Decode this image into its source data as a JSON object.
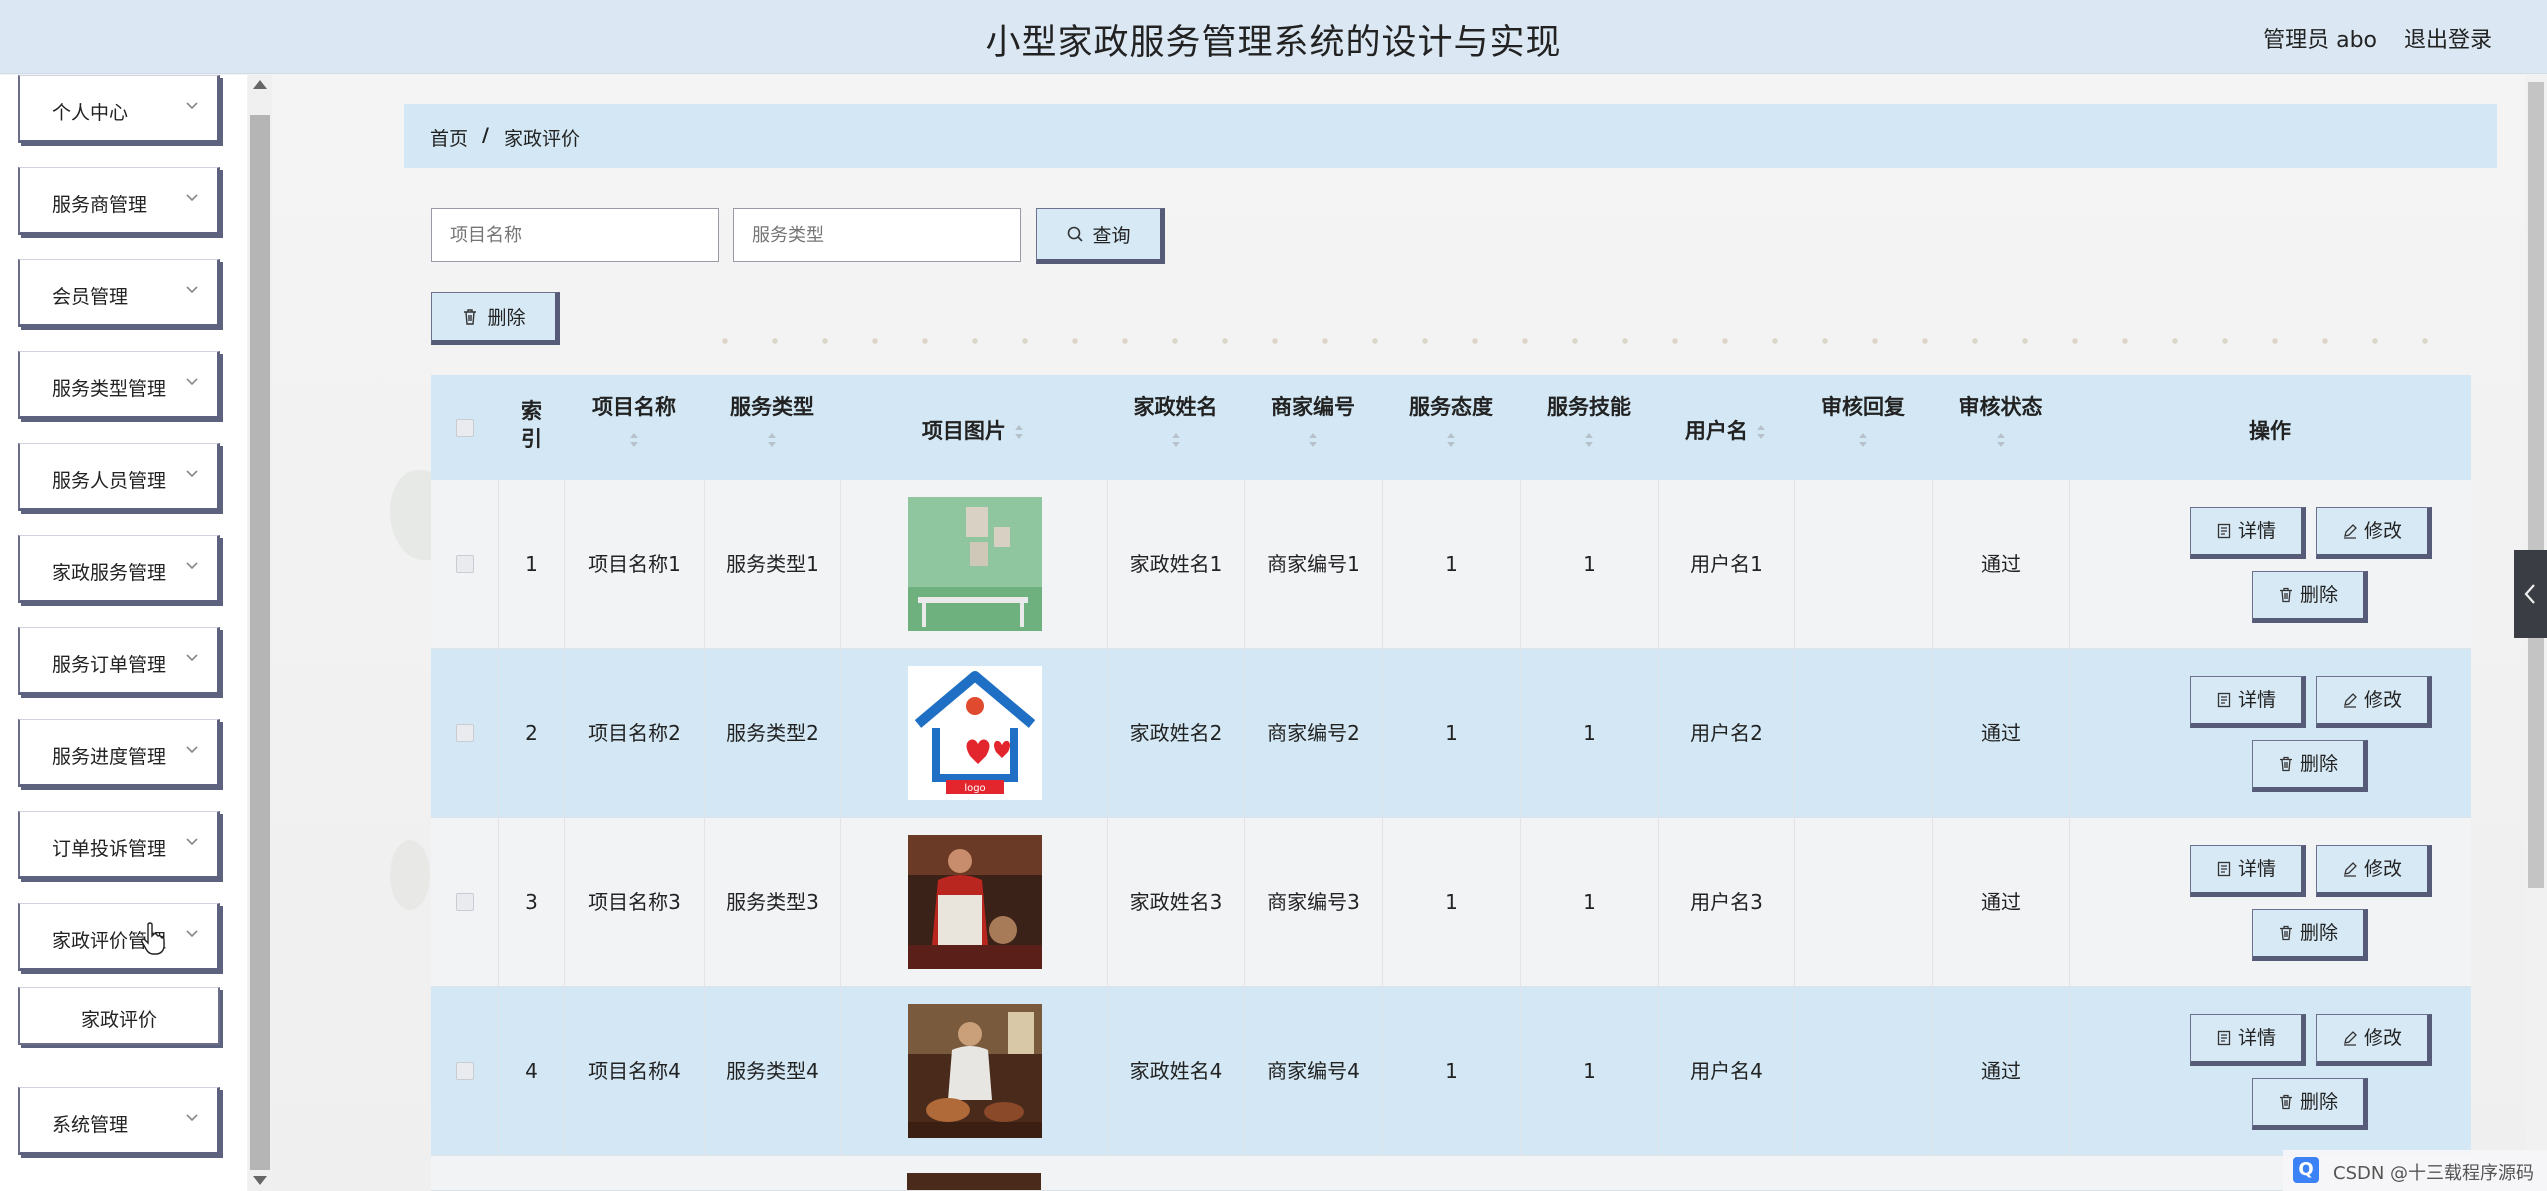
{
  "header": {
    "title": "小型家政服务管理系统的设计与实现",
    "user": "管理员 abo",
    "logout": "退出登录"
  },
  "sidebar": {
    "items": [
      {
        "label": "个人中心"
      },
      {
        "label": "服务商管理"
      },
      {
        "label": "会员管理"
      },
      {
        "label": "服务类型管理"
      },
      {
        "label": "服务人员管理"
      },
      {
        "label": "家政服务管理"
      },
      {
        "label": "服务订单管理"
      },
      {
        "label": "服务进度管理"
      },
      {
        "label": "订单投诉管理"
      },
      {
        "label": "家政评价管理"
      },
      {
        "label": "系统管理"
      }
    ],
    "submenu": {
      "label": "家政评价"
    }
  },
  "breadcrumb": {
    "home": "首页",
    "separator": "/",
    "current": "家政评价"
  },
  "search": {
    "project_placeholder": "项目名称",
    "type_placeholder": "服务类型",
    "query_label": "查询"
  },
  "toolbar": {
    "delete_label": "删除"
  },
  "table": {
    "headers": {
      "index": "索引",
      "project_name": "项目名称",
      "service_type": "服务类型",
      "project_image": "项目图片",
      "worker_name": "家政姓名",
      "merchant_no": "商家编号",
      "attitude": "服务态度",
      "skill": "服务技能",
      "username": "用户名",
      "review_reply": "审核回复",
      "review_status": "审核状态",
      "actions": "操作"
    },
    "rows": [
      {
        "index": "1",
        "project_name": "项目名称1",
        "service_type": "服务类型1",
        "worker_name": "家政姓名1",
        "merchant_no": "商家编号1",
        "attitude": "1",
        "skill": "1",
        "username": "用户名1",
        "review_reply": "",
        "review_status": "通过"
      },
      {
        "index": "2",
        "project_name": "项目名称2",
        "service_type": "服务类型2",
        "worker_name": "家政姓名2",
        "merchant_no": "商家编号2",
        "attitude": "1",
        "skill": "1",
        "username": "用户名2",
        "review_reply": "",
        "review_status": "通过"
      },
      {
        "index": "3",
        "project_name": "项目名称3",
        "service_type": "服务类型3",
        "worker_name": "家政姓名3",
        "merchant_no": "商家编号3",
        "attitude": "1",
        "skill": "1",
        "username": "用户名3",
        "review_reply": "",
        "review_status": "通过"
      },
      {
        "index": "4",
        "project_name": "项目名称4",
        "service_type": "服务类型4",
        "worker_name": "家政姓名4",
        "merchant_no": "商家编号4",
        "attitude": "1",
        "skill": "1",
        "username": "用户名4",
        "review_reply": "",
        "review_status": "通过"
      }
    ],
    "actions": {
      "detail": "详情",
      "edit": "修改",
      "delete": "删除"
    }
  },
  "watermark": {
    "text": "CSDN @十三载程序源码"
  }
}
